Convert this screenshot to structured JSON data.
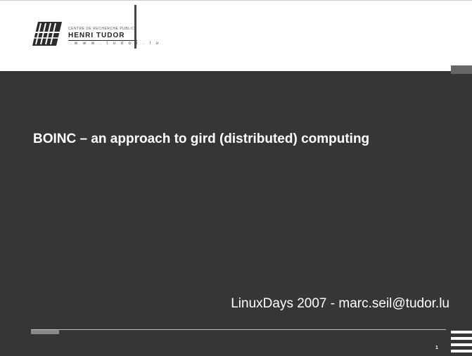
{
  "logo": {
    "org_line": "CENTRE DE RECHERCHE PUBLIC",
    "name": "HENRI TUDOR",
    "url": "w w w . t u d o r . l u"
  },
  "slide": {
    "title": "BOINC – an approach to gird (distributed) computing",
    "subtitle": "LinuxDays 2007 - marc.seil@tudor.lu",
    "page_number": "1"
  },
  "colors": {
    "background_dark": "#363636",
    "text": "#ffffff"
  }
}
